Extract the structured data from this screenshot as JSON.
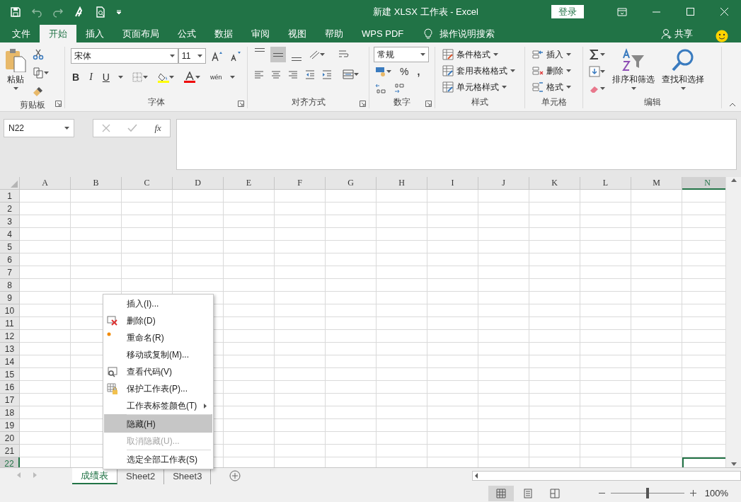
{
  "window": {
    "title": "新建 XLSX 工作表  -  Excel",
    "sign_in": "登录"
  },
  "ribbon_tabs": [
    {
      "label": "文件",
      "selected": false
    },
    {
      "label": "开始",
      "selected": true
    },
    {
      "label": "插入",
      "selected": false
    },
    {
      "label": "页面布局",
      "selected": false
    },
    {
      "label": "公式",
      "selected": false
    },
    {
      "label": "数据",
      "selected": false
    },
    {
      "label": "审阅",
      "selected": false
    },
    {
      "label": "视图",
      "selected": false
    },
    {
      "label": "帮助",
      "selected": false
    },
    {
      "label": "WPS PDF",
      "selected": false
    }
  ],
  "tell_me": "操作说明搜索",
  "share": "共享",
  "ribbon": {
    "clipboard": {
      "label": "剪贴板",
      "paste": "粘贴"
    },
    "font": {
      "label": "字体",
      "font_name": "宋体",
      "font_size": "11",
      "bold": "B",
      "italic": "I",
      "underline": "U",
      "phonetic": "wén"
    },
    "alignment": {
      "label": "对齐方式",
      "middle_selected": true
    },
    "number": {
      "label": "数字",
      "format": "常规",
      "percent": "%",
      "comma": ","
    },
    "styles": {
      "label": "样式",
      "items": [
        "条件格式",
        "套用表格格式",
        "单元格样式"
      ]
    },
    "cells": {
      "label": "单元格",
      "items": [
        "插入",
        "删除",
        "格式"
      ]
    },
    "editing": {
      "label": "编辑",
      "sort": "排序和筛选",
      "find": "查找和选择"
    }
  },
  "formula_bar": {
    "name_box": "N22",
    "fx": "fx"
  },
  "columns": [
    {
      "label": "A",
      "selected": false
    },
    {
      "label": "B",
      "selected": false
    },
    {
      "label": "C",
      "selected": false
    },
    {
      "label": "D",
      "selected": false
    },
    {
      "label": "E",
      "selected": false
    },
    {
      "label": "F",
      "selected": false
    },
    {
      "label": "G",
      "selected": false
    },
    {
      "label": "H",
      "selected": false
    },
    {
      "label": "I",
      "selected": false
    },
    {
      "label": "J",
      "selected": false
    },
    {
      "label": "K",
      "selected": false
    },
    {
      "label": "L",
      "selected": false
    },
    {
      "label": "M",
      "selected": false
    },
    {
      "label": "N",
      "selected": true
    }
  ],
  "rows": [
    {
      "label": "1",
      "selected": false
    },
    {
      "label": "2",
      "selected": false
    },
    {
      "label": "3",
      "selected": false
    },
    {
      "label": "4",
      "selected": false
    },
    {
      "label": "5",
      "selected": false
    },
    {
      "label": "6",
      "selected": false
    },
    {
      "label": "7",
      "selected": false
    },
    {
      "label": "8",
      "selected": false
    },
    {
      "label": "9",
      "selected": false
    },
    {
      "label": "10",
      "selected": false
    },
    {
      "label": "11",
      "selected": false
    },
    {
      "label": "12",
      "selected": false
    },
    {
      "label": "13",
      "selected": false
    },
    {
      "label": "14",
      "selected": false
    },
    {
      "label": "15",
      "selected": false
    },
    {
      "label": "16",
      "selected": false
    },
    {
      "label": "17",
      "selected": false
    },
    {
      "label": "18",
      "selected": false
    },
    {
      "label": "19",
      "selected": false
    },
    {
      "label": "20",
      "selected": false
    },
    {
      "label": "21",
      "selected": false
    },
    {
      "label": "22",
      "selected": true
    }
  ],
  "context_menu": [
    {
      "label": "插入(I)...",
      "kind": "plain",
      "disabled": false,
      "selected": false,
      "submenu": false,
      "separator_before": false
    },
    {
      "label": "删除(D)",
      "kind": "delete",
      "disabled": false,
      "selected": false,
      "submenu": false,
      "separator_before": false
    },
    {
      "label": "重命名(R)",
      "kind": "rename",
      "disabled": false,
      "selected": false,
      "submenu": false,
      "separator_before": false
    },
    {
      "label": "移动或复制(M)...",
      "kind": "plain",
      "disabled": false,
      "selected": false,
      "submenu": false,
      "separator_before": false
    },
    {
      "label": "查看代码(V)",
      "kind": "code",
      "disabled": false,
      "selected": false,
      "submenu": false,
      "separator_before": false
    },
    {
      "label": "保护工作表(P)...",
      "kind": "protect",
      "disabled": false,
      "selected": false,
      "submenu": false,
      "separator_before": false
    },
    {
      "label": "工作表标签颜色(T)",
      "kind": "plain",
      "disabled": false,
      "selected": false,
      "submenu": true,
      "separator_before": false
    },
    {
      "label": "隐藏(H)",
      "kind": "plain",
      "disabled": false,
      "selected": true,
      "submenu": false,
      "separator_before": true
    },
    {
      "label": "取消隐藏(U)...",
      "kind": "plain",
      "disabled": true,
      "selected": false,
      "submenu": false,
      "separator_before": false
    },
    {
      "label": "选定全部工作表(S)",
      "kind": "plain",
      "disabled": false,
      "selected": false,
      "submenu": false,
      "separator_before": true
    }
  ],
  "sheet_tabs": [
    {
      "label": "成绩表",
      "selected": true
    },
    {
      "label": "Sheet2",
      "selected": false
    },
    {
      "label": "Sheet3",
      "selected": false
    }
  ],
  "status_bar": {
    "views": [
      {
        "kind": "normal",
        "selected": true
      },
      {
        "kind": "layout",
        "selected": false
      },
      {
        "kind": "pagebreak",
        "selected": false
      }
    ],
    "zoom": {
      "level": 0.5,
      "reading": "100%"
    }
  }
}
